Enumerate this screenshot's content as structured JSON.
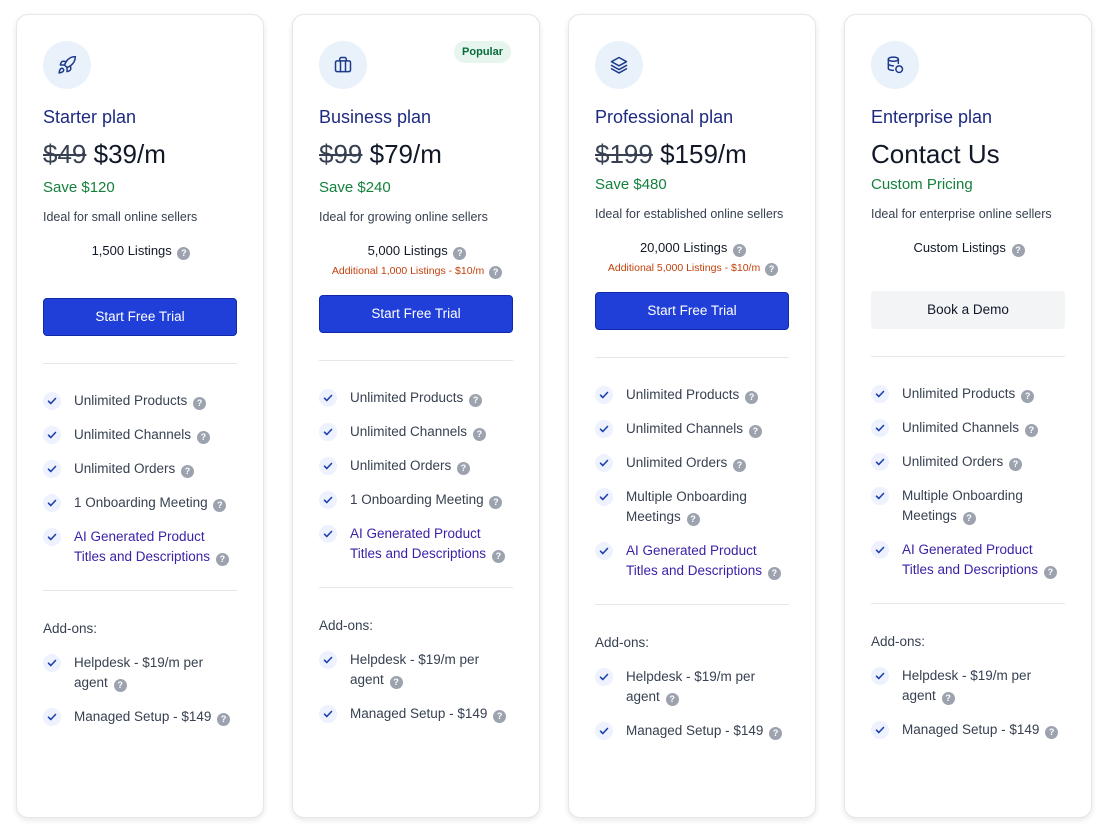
{
  "plans": [
    {
      "name": "Starter plan",
      "icon": "rocket-icon",
      "old_price": "$49",
      "new_price": "$39/m",
      "save": "Save $120",
      "description": "Ideal for small online sellers",
      "listings": "1,500 Listings",
      "button": "Start Free Trial",
      "features": [
        "Unlimited Products",
        "Unlimited Channels",
        "Unlimited Orders",
        "1 Onboarding Meeting",
        "AI Generated Product Titles and Descriptions"
      ],
      "addons_label": "Add-ons:",
      "addons": [
        "Helpdesk - $19/m per agent",
        "Managed Setup - $149"
      ]
    },
    {
      "name": "Business plan",
      "icon": "briefcase-icon",
      "badge": "Popular",
      "old_price": "$99",
      "new_price": "$79/m",
      "save": "Save $240",
      "description": "Ideal for growing online sellers",
      "listings": "5,000 Listings",
      "additional": "Additional 1,000 Listings - $10/m",
      "button": "Start Free Trial",
      "features": [
        "Unlimited Products",
        "Unlimited Channels",
        "Unlimited Orders",
        "1 Onboarding Meeting",
        "AI Generated Product Titles and Descriptions"
      ],
      "addons_label": "Add-ons:",
      "addons": [
        "Helpdesk - $19/m per agent",
        "Managed Setup - $149"
      ]
    },
    {
      "name": "Professional plan",
      "icon": "layers-icon",
      "old_price": "$199",
      "new_price": "$159/m",
      "save": "Save $480",
      "description": "Ideal for established online sellers",
      "listings": "20,000 Listings",
      "additional": "Additional 5,000 Listings - $10/m",
      "button": "Start Free Trial",
      "features": [
        "Unlimited Products",
        "Unlimited Channels",
        "Unlimited Orders",
        "Multiple Onboarding Meetings",
        "AI Generated Product Titles and Descriptions"
      ],
      "addons_label": "Add-ons:",
      "addons": [
        "Helpdesk - $19/m per agent",
        "Managed Setup - $149"
      ]
    },
    {
      "name": "Enterprise plan",
      "icon": "database-icon",
      "price_text": "Contact Us",
      "save": "Custom Pricing",
      "description": "Ideal for enterprise online sellers",
      "listings": "Custom Listings",
      "button": "Book a Demo",
      "features": [
        "Unlimited Products",
        "Unlimited Channels",
        "Unlimited Orders",
        "Multiple Onboarding Meetings",
        "AI Generated Product Titles and Descriptions"
      ],
      "addons_label": "Add-ons:",
      "addons": [
        "Helpdesk - $19/m per agent",
        "Managed Setup - $149"
      ]
    }
  ],
  "colors": {
    "primary_button": "#1f3fd8",
    "plan_name": "#1e2a80",
    "save_green": "#15803d",
    "additional_orange": "#c2410c",
    "ai_feature": "#3b1fa8"
  }
}
